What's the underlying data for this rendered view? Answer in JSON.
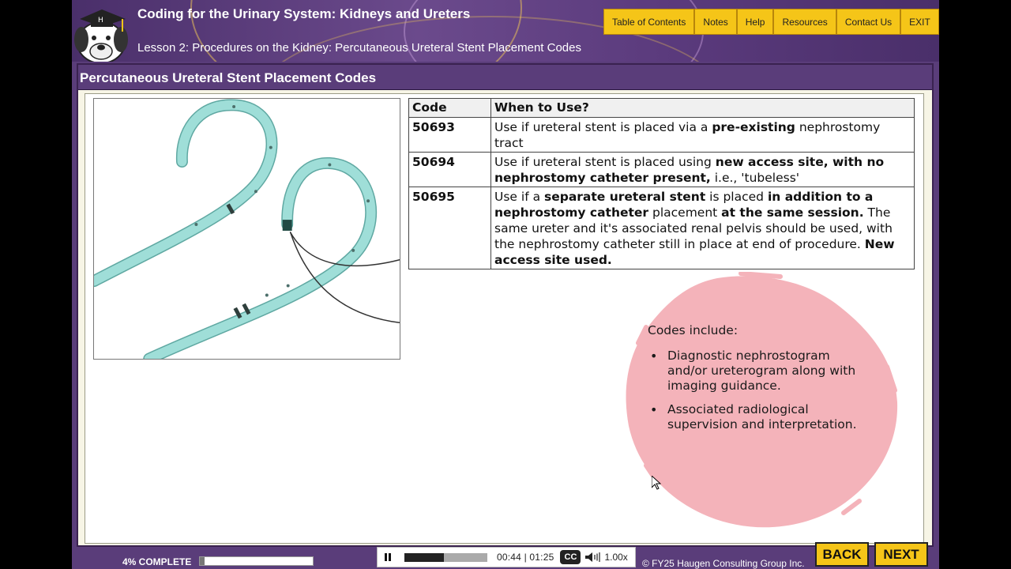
{
  "header": {
    "course_title": "Coding for the Urinary System: Kidneys and Ureters",
    "lesson_title": "Lesson 2: Procedures on the Kidney: Percutaneous Ureteral Stent Placement Codes"
  },
  "nav": {
    "table_of_contents": "Table of Contents",
    "notes": "Notes",
    "help": "Help",
    "resources": "Resources",
    "contact_us": "Contact Us",
    "exit": "EXIT"
  },
  "section_title": "Percutaneous Ureteral Stent Placement Codes",
  "table": {
    "col_code": "Code",
    "col_when": "When to Use?",
    "rows": [
      {
        "code": "50693",
        "p1": "Use if ureteral stent is placed via a ",
        "b1": "pre-existing",
        "p2": " nephrostomy tract"
      },
      {
        "code": "50694",
        "p1": "Use if ureteral stent is placed using ",
        "b1": "new access site, with no nephrostomy catheter present,",
        "p2": " i.e., 'tubeless'"
      },
      {
        "code": "50695",
        "p1": "Use if a ",
        "b1": "separate ureteral stent",
        "p2": " is placed ",
        "b2": "in addition to a nephrostomy catheter",
        "p3": " placement ",
        "b3": "at the same session.",
        "p4": " The same ureter and it's associated renal pelvis should be used, with the nephrostomy catheter still in place at end of procedure. ",
        "b4": "New access site used."
      }
    ]
  },
  "includes": {
    "heading": "Codes include:",
    "items": [
      "Diagnostic nephrostogram and/or ureterogram along with imaging guidance.",
      "Associated radiological supervision and interpretation."
    ]
  },
  "footer": {
    "progress_label": "4% COMPLETE",
    "progress_fraction": 0.04,
    "seek_fraction": 0.48,
    "time": "00:44 | 01:25",
    "cc": "CC",
    "speed": "1.00x",
    "copyright": "© FY25 Haugen Consulting Group Inc.",
    "back": "BACK",
    "next": "NEXT"
  },
  "colors": {
    "header_purple": "#5a3d7a",
    "nav_yellow": "#f5c518",
    "stent_teal": "#9fded8",
    "blob_pink": "#f4b3ba"
  }
}
